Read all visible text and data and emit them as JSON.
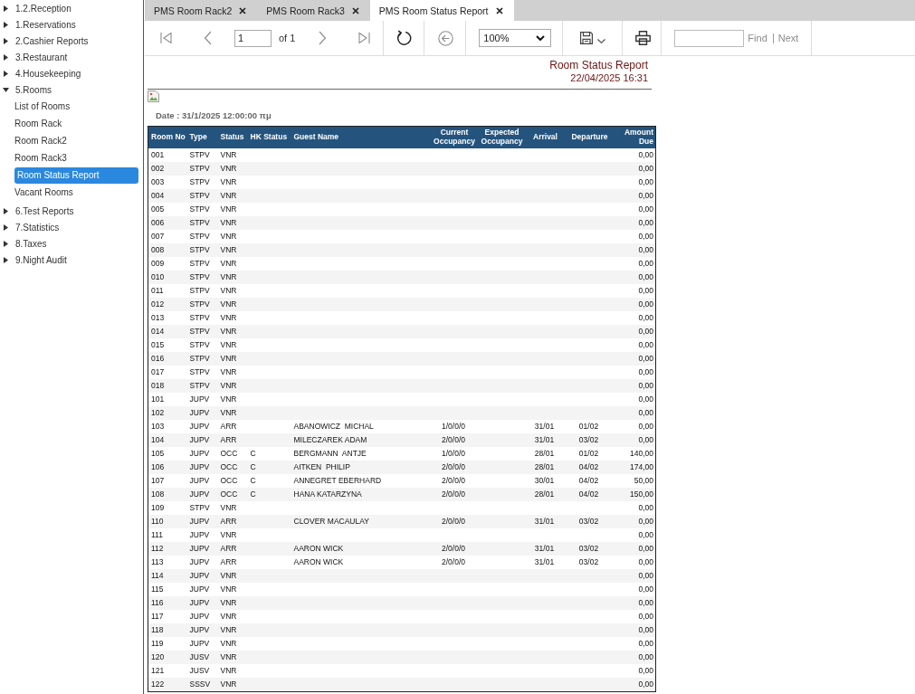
{
  "sidebar": {
    "items": [
      {
        "label": "1.2.Reception",
        "expanded": false
      },
      {
        "label": "1.Reservations",
        "expanded": false
      },
      {
        "label": "2.Cashier Reports",
        "expanded": false
      },
      {
        "label": "3.Restaurant",
        "expanded": false
      },
      {
        "label": "4.Housekeeping",
        "expanded": false
      },
      {
        "label": "5.Rooms",
        "expanded": true,
        "children": [
          {
            "label": "List of Rooms",
            "selected": false
          },
          {
            "label": "Room Rack",
            "selected": false
          },
          {
            "label": "Room Rack2",
            "selected": false
          },
          {
            "label": "Room Rack3",
            "selected": false
          },
          {
            "label": "Room Status Report",
            "selected": true
          },
          {
            "label": "Vacant Rooms",
            "selected": false
          }
        ]
      },
      {
        "label": "6.Test Reports",
        "expanded": false
      },
      {
        "label": "7.Statistics",
        "expanded": false
      },
      {
        "label": "8.Taxes",
        "expanded": false
      },
      {
        "label": "9.Night Audit",
        "expanded": false
      }
    ]
  },
  "tabs": [
    {
      "label": "PMS Room Rack2",
      "selected": false
    },
    {
      "label": "PMS Room Rack3",
      "selected": false
    },
    {
      "label": "PMS Room Status Report",
      "selected": true
    }
  ],
  "toolbar": {
    "groups": [
      {
        "items": [
          {
            "kind": "first",
            "disabled": true
          },
          {
            "kind": "prev",
            "disabled": true
          },
          {
            "kind": "page",
            "value": "1",
            "count": "of 1"
          },
          {
            "kind": "next",
            "disabled": true
          },
          {
            "kind": "last",
            "disabled": true
          }
        ]
      },
      {
        "items": [
          {
            "kind": "refresh",
            "disabled": false
          }
        ]
      },
      {
        "items": [
          {
            "kind": "back",
            "disabled": true
          }
        ]
      },
      {
        "items": [
          {
            "kind": "zoom",
            "value": "100%"
          }
        ]
      },
      {
        "items": [
          {
            "kind": "save",
            "disabled": false
          }
        ]
      },
      {
        "items": [
          {
            "kind": "print",
            "disabled": false
          }
        ]
      },
      {
        "items": [
          {
            "kind": "find",
            "find_label": "Find",
            "next_label": "Next",
            "disabled": true
          }
        ]
      }
    ]
  },
  "report": {
    "title": "Room Status Report",
    "generated": "22/04/2025 16:31",
    "date_label": "Date : 31/1/2025 12:00:00 πμ",
    "table": {
      "columns": [
        "Room No",
        "Type",
        "Status",
        "HK Status",
        "Guest Name",
        "Current Occupancy",
        "Expected Occupancy",
        "Arrival",
        "Departure",
        "Amount Due"
      ],
      "rows": [
        {
          "room_no": "001",
          "type": "STPV",
          "status": "VNR",
          "amount_due": "0,00"
        },
        {
          "room_no": "002",
          "type": "STPV",
          "status": "VNR",
          "amount_due": "0,00"
        },
        {
          "room_no": "003",
          "type": "STPV",
          "status": "VNR",
          "amount_due": "0,00"
        },
        {
          "room_no": "004",
          "type": "STPV",
          "status": "VNR",
          "amount_due": "0,00"
        },
        {
          "room_no": "005",
          "type": "STPV",
          "status": "VNR",
          "amount_due": "0,00"
        },
        {
          "room_no": "006",
          "type": "STPV",
          "status": "VNR",
          "amount_due": "0,00"
        },
        {
          "room_no": "007",
          "type": "STPV",
          "status": "VNR",
          "amount_due": "0,00"
        },
        {
          "room_no": "008",
          "type": "STPV",
          "status": "VNR",
          "amount_due": "0,00"
        },
        {
          "room_no": "009",
          "type": "STPV",
          "status": "VNR",
          "amount_due": "0,00"
        },
        {
          "room_no": "010",
          "type": "STPV",
          "status": "VNR",
          "amount_due": "0,00"
        },
        {
          "room_no": "011",
          "type": "STPV",
          "status": "VNR",
          "amount_due": "0,00"
        },
        {
          "room_no": "012",
          "type": "STPV",
          "status": "VNR",
          "amount_due": "0,00"
        },
        {
          "room_no": "013",
          "type": "STPV",
          "status": "VNR",
          "amount_due": "0,00"
        },
        {
          "room_no": "014",
          "type": "STPV",
          "status": "VNR",
          "amount_due": "0,00"
        },
        {
          "room_no": "015",
          "type": "STPV",
          "status": "VNR",
          "amount_due": "0,00"
        },
        {
          "room_no": "016",
          "type": "STPV",
          "status": "VNR",
          "amount_due": "0,00"
        },
        {
          "room_no": "017",
          "type": "STPV",
          "status": "VNR",
          "amount_due": "0,00"
        },
        {
          "room_no": "018",
          "type": "STPV",
          "status": "VNR",
          "amount_due": "0,00"
        },
        {
          "room_no": "101",
          "type": "JUPV",
          "status": "VNR",
          "amount_due": "0,00"
        },
        {
          "room_no": "102",
          "type": "JUPV",
          "status": "VNR",
          "amount_due": "0,00"
        },
        {
          "room_no": "103",
          "type": "JUPV",
          "status": "ARR",
          "guest_name": "ABANOWICZ  MICHAL",
          "current_occupancy": "1/0/0/0",
          "arrival": "31/01",
          "departure": "01/02",
          "amount_due": "0,00"
        },
        {
          "room_no": "104",
          "type": "JUPV",
          "status": "ARR",
          "guest_name": "MILECZAREK ADAM",
          "current_occupancy": "2/0/0/0",
          "arrival": "31/01",
          "departure": "03/02",
          "amount_due": "0,00"
        },
        {
          "room_no": "105",
          "type": "JUPV",
          "status": "OCC",
          "hk_status": "C",
          "guest_name": "BERGMANN  ANTJE",
          "current_occupancy": "1/0/0/0",
          "arrival": "28/01",
          "departure": "01/02",
          "amount_due": "140,00"
        },
        {
          "room_no": "106",
          "type": "JUPV",
          "status": "OCC",
          "hk_status": "C",
          "guest_name": "AITKEN  PHILIP",
          "current_occupancy": "2/0/0/0",
          "arrival": "28/01",
          "departure": "04/02",
          "amount_due": "174,00"
        },
        {
          "room_no": "107",
          "type": "JUPV",
          "status": "OCC",
          "hk_status": "C",
          "guest_name": "ANNEGRET EBERHARD",
          "current_occupancy": "2/0/0/0",
          "arrival": "30/01",
          "departure": "04/02",
          "amount_due": "50,00"
        },
        {
          "room_no": "108",
          "type": "JUPV",
          "status": "OCC",
          "hk_status": "C",
          "guest_name": "HANA KATARZYNA",
          "current_occupancy": "2/0/0/0",
          "arrival": "28/01",
          "departure": "04/02",
          "amount_due": "150,00"
        },
        {
          "room_no": "109",
          "type": "STPV",
          "status": "VNR",
          "amount_due": "0,00"
        },
        {
          "room_no": "110",
          "type": "JUPV",
          "status": "ARR",
          "guest_name": "CLOVER MACAULAY",
          "current_occupancy": "2/0/0/0",
          "arrival": "31/01",
          "departure": "03/02",
          "amount_due": "0,00"
        },
        {
          "room_no": "111",
          "type": "JUPV",
          "status": "VNR",
          "amount_due": "0,00"
        },
        {
          "room_no": "112",
          "type": "JUPV",
          "status": "ARR",
          "guest_name": "AARON WICK",
          "current_occupancy": "2/0/0/0",
          "arrival": "31/01",
          "departure": "03/02",
          "amount_due": "0,00"
        },
        {
          "room_no": "113",
          "type": "JUPV",
          "status": "ARR",
          "guest_name": "AARON WICK",
          "current_occupancy": "2/0/0/0",
          "arrival": "31/01",
          "departure": "03/02",
          "amount_due": "0,00"
        },
        {
          "room_no": "114",
          "type": "JUPV",
          "status": "VNR",
          "amount_due": "0,00"
        },
        {
          "room_no": "115",
          "type": "JUPV",
          "status": "VNR",
          "amount_due": "0,00"
        },
        {
          "room_no": "116",
          "type": "JUPV",
          "status": "VNR",
          "amount_due": "0,00"
        },
        {
          "room_no": "117",
          "type": "JUPV",
          "status": "VNR",
          "amount_due": "0,00"
        },
        {
          "room_no": "118",
          "type": "JUPV",
          "status": "VNR",
          "amount_due": "0,00"
        },
        {
          "room_no": "119",
          "type": "JUPV",
          "status": "VNR",
          "amount_due": "0,00"
        },
        {
          "room_no": "120",
          "type": "JUSV",
          "status": "VNR",
          "amount_due": "0,00"
        },
        {
          "room_no": "121",
          "type": "JUSV",
          "status": "VNR",
          "amount_due": "0,00"
        },
        {
          "room_no": "122",
          "type": "SSSV",
          "status": "VNR",
          "amount_due": "0,00"
        }
      ]
    }
  }
}
